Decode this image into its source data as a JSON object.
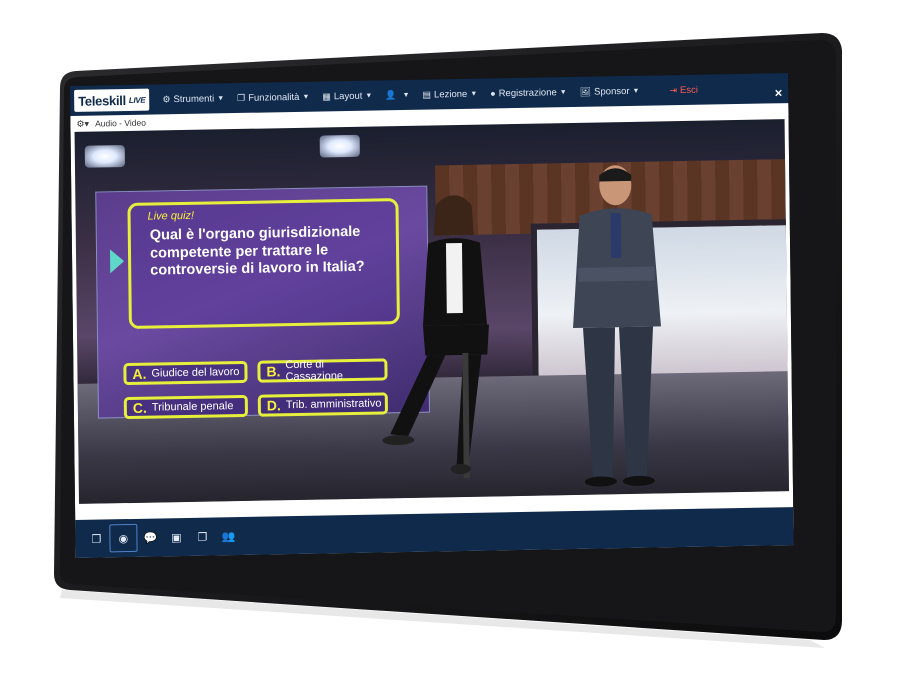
{
  "app": {
    "logo_text": "Teleskill",
    "logo_suffix": "LIVE"
  },
  "menu": {
    "items": [
      {
        "label": "Strumenti",
        "icon": "gear-icon"
      },
      {
        "label": "Funzionalità",
        "icon": "window-icon"
      },
      {
        "label": "Layout",
        "icon": "grid-icon"
      },
      {
        "label": "",
        "icon": "user-icon"
      },
      {
        "label": "Lezione",
        "icon": "classroom-icon"
      },
      {
        "label": "Registrazione",
        "icon": "record-dot-icon"
      },
      {
        "label": "Sponsor",
        "icon": "image-icon"
      }
    ],
    "exit_label": "Esci",
    "exit_color": "#ff5a52"
  },
  "panel": {
    "title": "Audio - Video",
    "close_glyph": "×"
  },
  "quiz": {
    "tag": "Live quiz!",
    "question": "Qual è l'organo giurisdizionale competente per trattare le controversie di lavoro in Italia?",
    "answers": [
      {
        "letter": "A.",
        "text": "Giudice del lavoro"
      },
      {
        "letter": "B.",
        "text": "Corte di Cassazione"
      },
      {
        "letter": "C.",
        "text": "Tribunale penale"
      },
      {
        "letter": "D.",
        "text": "Trib. amministrativo"
      }
    ],
    "accent_color": "#e6f03b"
  },
  "toolbar": {
    "buttons": [
      {
        "icon": "stack-icon",
        "active": false
      },
      {
        "icon": "webcam-icon",
        "active": true
      },
      {
        "icon": "chat-icon",
        "active": false
      },
      {
        "icon": "picture-icon",
        "active": false
      },
      {
        "icon": "copy-icon",
        "active": false
      },
      {
        "icon": "users-icon",
        "active": false
      }
    ]
  },
  "colors": {
    "bar_bg": "#0f2a4a",
    "frame": "#1b1b1d"
  }
}
